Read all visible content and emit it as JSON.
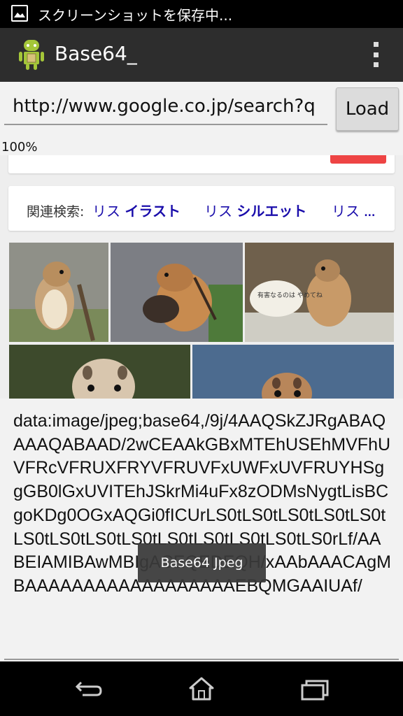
{
  "status": {
    "notification_text": "スクリーンショットを保存中..."
  },
  "app": {
    "title": "Base64_"
  },
  "url": {
    "value": "http://www.google.co.jp/search?q"
  },
  "load_label": "Load",
  "progress": "100%",
  "related": {
    "label": "関連検索:",
    "links": [
      {
        "prefix": "リス ",
        "bold": "イラスト"
      },
      {
        "prefix": "リス ",
        "bold": "シルエット"
      },
      {
        "prefix": "リス ",
        "bold": "..."
      }
    ]
  },
  "speech_bubble": "有害なるのは やめてね",
  "output_text": "data:image/jpeg;base64,/9j/4AAQSkZJRgABAQAAAQABAAD/2wCEAAkGBxMTEhUSEhMVFhUVFRcVFRUXFRYVFRUVFxUWFxUVFRUYHSggGB0lGxUVITEhJSkrMi4uFx8zODMsNygtLisBCgoKDg0OGxAQGi0fICUrLS0tLS0tLS0tLS0tLS0tLS0tLS0tLS0tLS0tLS0tLS0tLS0tLS0tLS0rLf/AABEIAMIBAwMBIgACEQEDEQH/xAAbAAACAgMBAAAAAAAAAAAAAAAAAAEBQMGAAIUAf/",
  "toast": "Base64 Jpeg",
  "colors": {
    "accent_red": "#ee4444",
    "link_blue": "#1a0dab",
    "actionbar": "#2d2d2d"
  }
}
